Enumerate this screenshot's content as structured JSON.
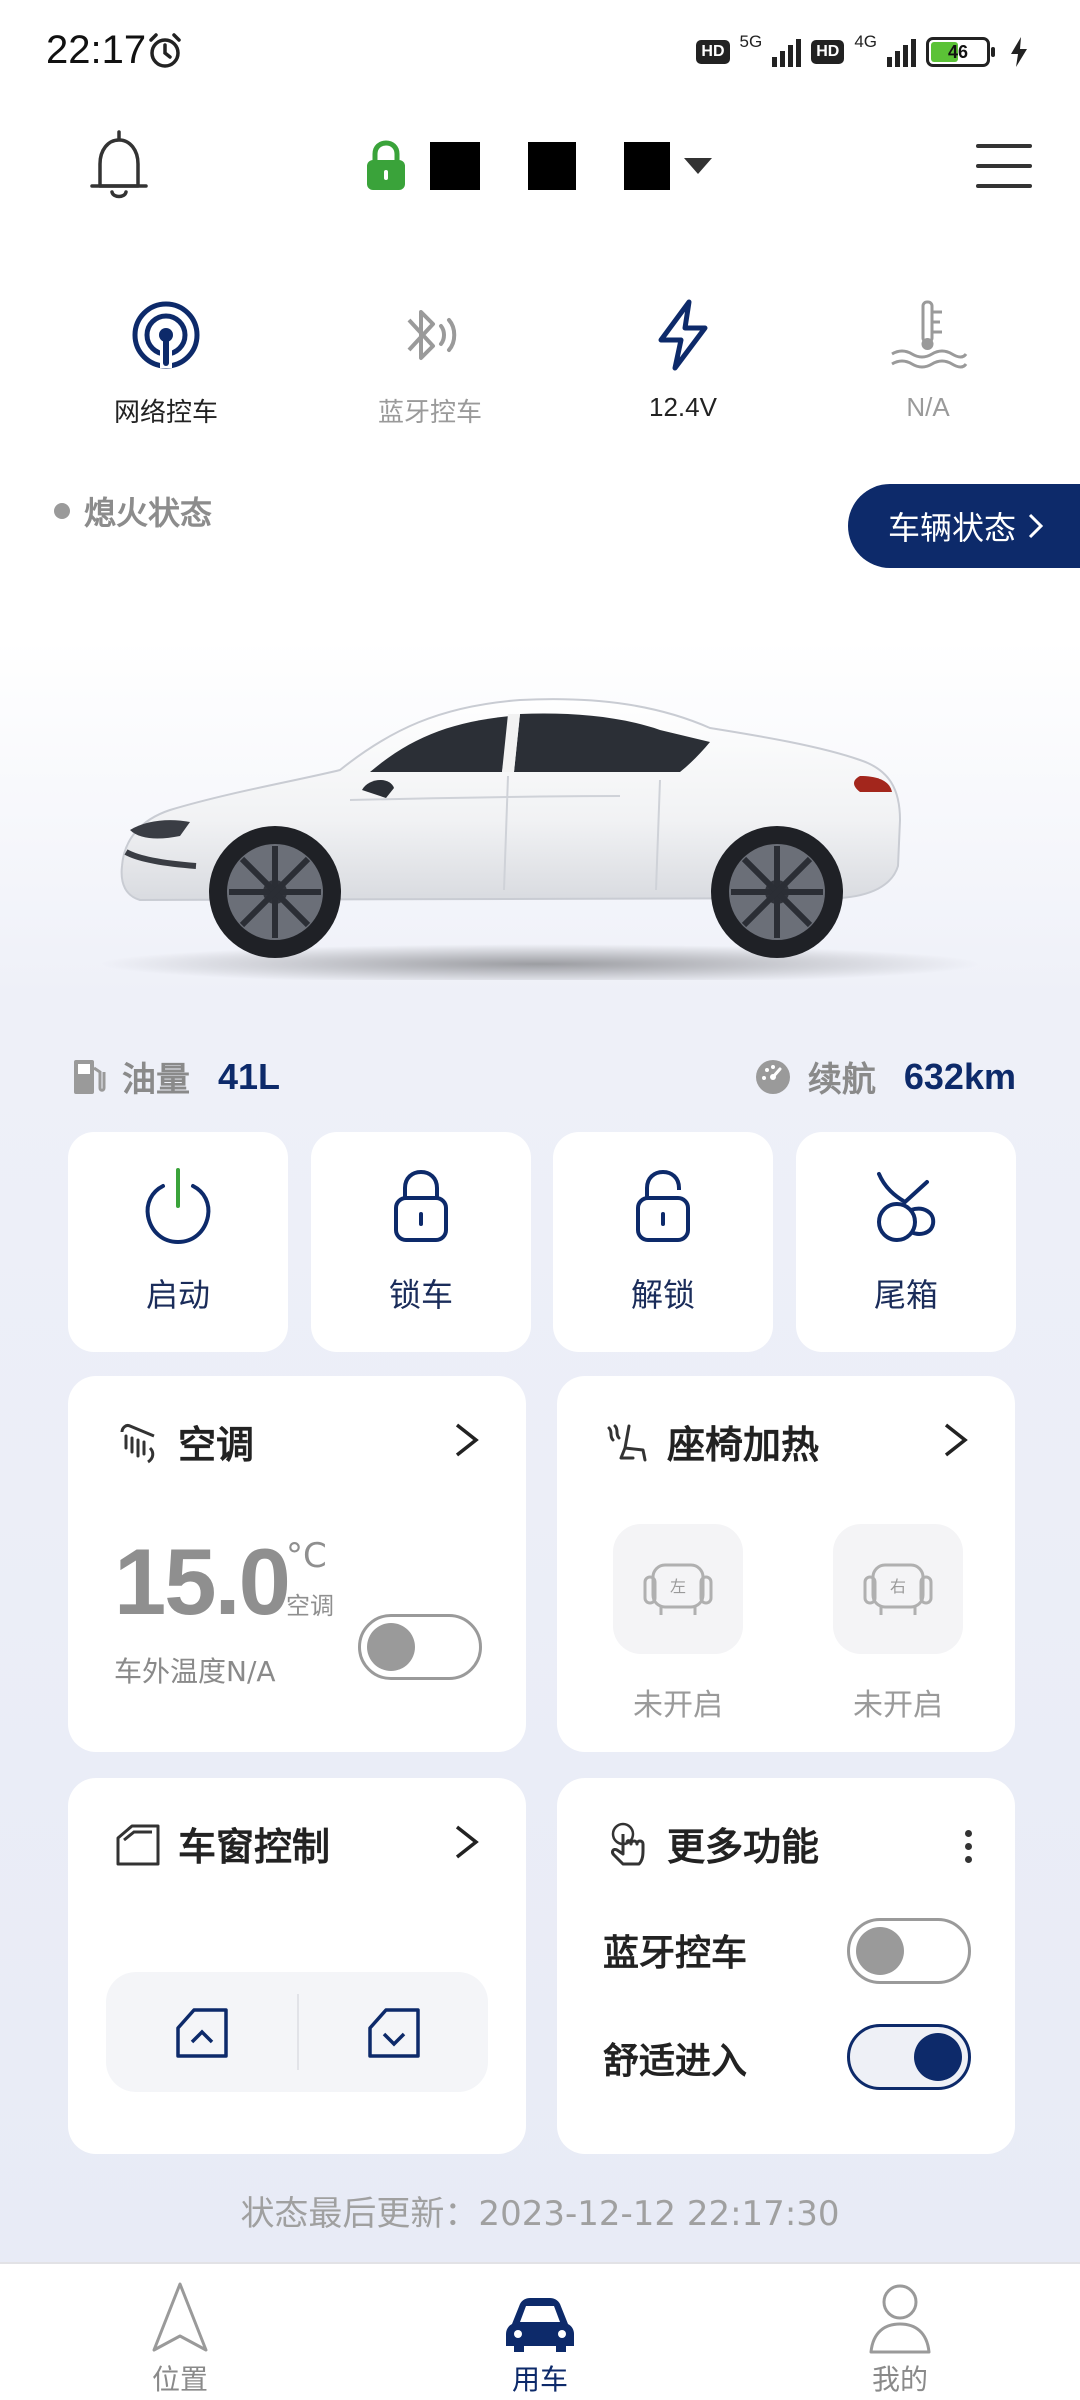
{
  "status_bar": {
    "time": "22:17",
    "hd1": "HD",
    "net1": "5G",
    "hd2": "HD",
    "net2": "4G",
    "battery": "46",
    "icons": [
      "alarm-icon",
      "signal-icon",
      "battery-icon",
      "charging-icon"
    ]
  },
  "header": {
    "icons": [
      "bell-icon",
      "lock-icon",
      "menu-icon"
    ],
    "plate_redacted": true
  },
  "quick_status": [
    {
      "label": "网络控车",
      "icon": "network-control-icon",
      "active": true
    },
    {
      "label": "蓝牙控车",
      "icon": "bluetooth-control-icon",
      "active": false
    },
    {
      "label": "12.4V",
      "icon": "battery-voltage-icon",
      "active": true
    },
    {
      "label": "N/A",
      "icon": "coolant-temp-icon",
      "active": false
    }
  ],
  "ignition": {
    "label": "熄火状态"
  },
  "vehicle_status_button": {
    "label": "车辆状态"
  },
  "fuel": {
    "label": "油量",
    "value": "41L"
  },
  "range": {
    "label": "续航",
    "value": "632km"
  },
  "actions": [
    {
      "label": "启动",
      "icon": "power-icon"
    },
    {
      "label": "锁车",
      "icon": "lock-icon"
    },
    {
      "label": "解锁",
      "icon": "unlock-icon"
    },
    {
      "label": "尾箱",
      "icon": "trunk-icon"
    }
  ],
  "ac": {
    "title": "空调",
    "temperature": "15.0",
    "unit": "°C",
    "sub": "空调",
    "outside": "车外温度N/A",
    "on": false
  },
  "seat_heating": {
    "title": "座椅加热",
    "left": {
      "glyph": "左",
      "status": "未开启"
    },
    "right": {
      "glyph": "右",
      "status": "未开启"
    }
  },
  "window": {
    "title": "车窗控制"
  },
  "more": {
    "title": "更多功能",
    "rows": [
      {
        "label": "蓝牙控车",
        "on": false
      },
      {
        "label": "舒适进入",
        "on": true
      }
    ]
  },
  "last_update": "状态最后更新：2023-12-12 22:17:30",
  "nav": [
    {
      "label": "位置",
      "icon": "navigation-arrow-icon"
    },
    {
      "label": "用车",
      "icon": "car-icon"
    },
    {
      "label": "我的",
      "icon": "person-icon"
    }
  ],
  "colors": {
    "primary": "#0d2a6a",
    "lock_green": "#3aa33a",
    "muted": "#9a9a9a",
    "background": "#e8ebf6"
  }
}
